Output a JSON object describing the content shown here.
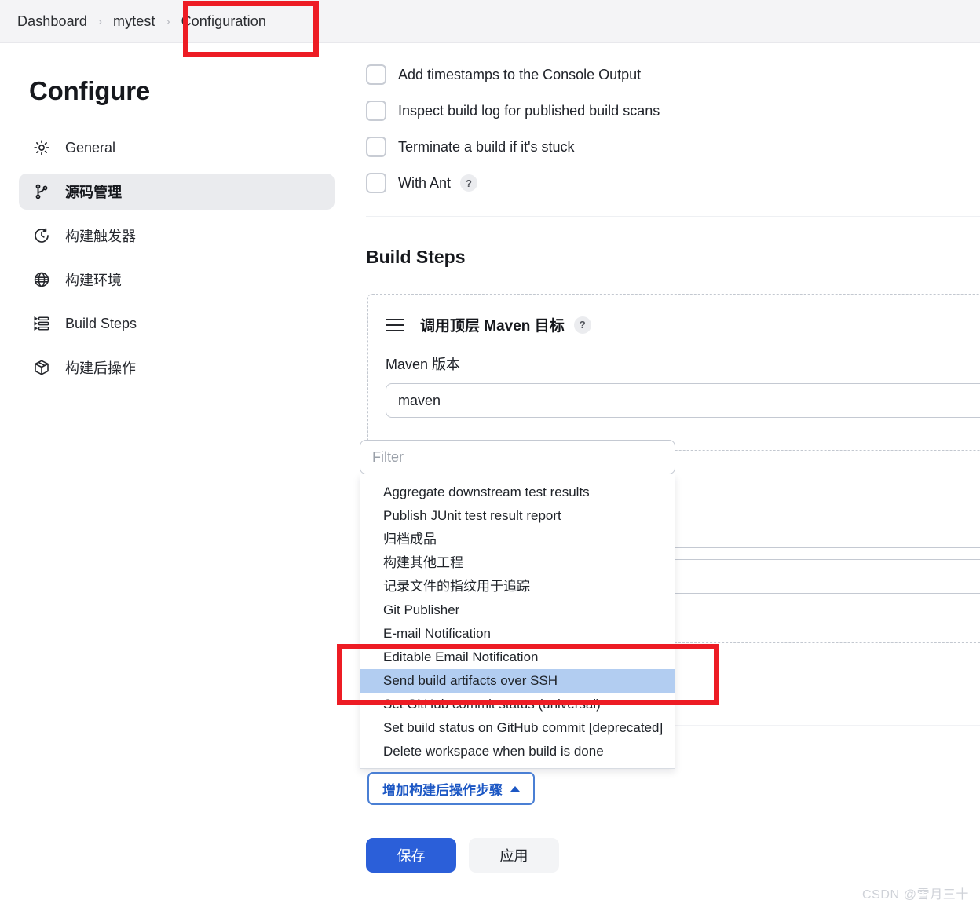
{
  "breadcrumb": {
    "items": [
      "Dashboard",
      "mytest",
      "Configuration"
    ],
    "separator": "›"
  },
  "sidebar": {
    "title": "Configure",
    "items": [
      {
        "label": "General",
        "icon": "gear-icon",
        "active": false
      },
      {
        "label": "源码管理",
        "icon": "branch-icon",
        "active": true
      },
      {
        "label": "构建触发器",
        "icon": "clock-icon",
        "active": false
      },
      {
        "label": "构建环境",
        "icon": "globe-icon",
        "active": false
      },
      {
        "label": "Build Steps",
        "icon": "list-steps-icon",
        "active": false
      },
      {
        "label": "构建后操作",
        "icon": "package-icon",
        "active": false
      }
    ]
  },
  "main": {
    "checkboxes": [
      {
        "label": "Add timestamps to the Console Output",
        "checked": false,
        "help": false
      },
      {
        "label": "Inspect build log for published build scans",
        "checked": false,
        "help": false
      },
      {
        "label": "Terminate a build if it's stuck",
        "checked": false,
        "help": false
      },
      {
        "label": "With Ant",
        "checked": false,
        "help": true
      }
    ],
    "help_badge": "?",
    "section_title": "Build Steps",
    "build_step": {
      "title": "调用顶层 Maven 目标",
      "help": "?",
      "field_label": "Maven 版本",
      "field_value": "maven"
    },
    "filter": {
      "placeholder": "Filter",
      "value": ""
    },
    "dropdown": {
      "items": [
        {
          "label": "Aggregate downstream test results",
          "selected": false
        },
        {
          "label": "Publish JUnit test result report",
          "selected": false
        },
        {
          "label": "归档成品",
          "selected": false
        },
        {
          "label": "构建其他工程",
          "selected": false
        },
        {
          "label": "记录文件的指纹用于追踪",
          "selected": false
        },
        {
          "label": "Git Publisher",
          "selected": false
        },
        {
          "label": "E-mail Notification",
          "selected": false
        },
        {
          "label": "Editable Email Notification",
          "selected": false
        },
        {
          "label": "Send build artifacts over SSH",
          "selected": true
        },
        {
          "label": "Set GitHub commit status (universal)",
          "selected": false
        },
        {
          "label": "Set build status on GitHub commit [deprecated]",
          "selected": false
        },
        {
          "label": "Delete workspace when build is done",
          "selected": false
        }
      ]
    },
    "add_step_button": {
      "label": "增加构建后操作步骤",
      "caret": "▲"
    },
    "save_button": "保存",
    "apply_button": "应用"
  },
  "annotations": {
    "color": "#ed1c24",
    "boxes": [
      "configuration-tab",
      "send-build-artifacts-over-ssh"
    ]
  },
  "watermark": "CSDN @雪月三十"
}
